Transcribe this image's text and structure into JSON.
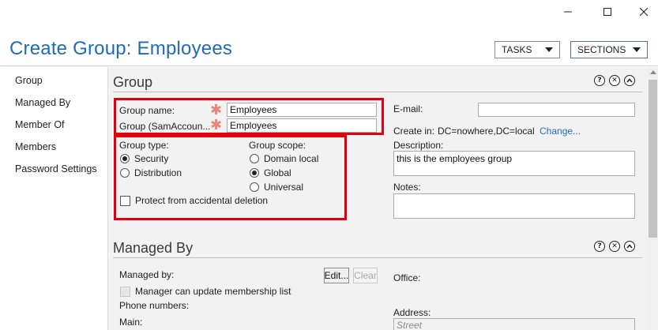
{
  "window": {
    "minimize_icon": "minimize-icon",
    "maximize_icon": "maximize-icon",
    "close_icon": "close-icon"
  },
  "header": {
    "title": "Create Group: Employees",
    "tasks_label": "TASKS",
    "sections_label": "SECTIONS"
  },
  "nav": {
    "items": [
      {
        "label": "Group"
      },
      {
        "label": "Managed By"
      },
      {
        "label": "Member Of"
      },
      {
        "label": "Members"
      },
      {
        "label": "Password Settings"
      }
    ]
  },
  "group_section": {
    "title": "Group",
    "group_name_label": "Group name:",
    "group_name_value": "Employees",
    "sam_label": "Group (SamAccoun...",
    "sam_value": "Employees",
    "group_type_label": "Group type:",
    "type_options": [
      {
        "label": "Security",
        "selected": true
      },
      {
        "label": "Distribution",
        "selected": false
      }
    ],
    "group_scope_label": "Group scope:",
    "scope_options": [
      {
        "label": "Domain local",
        "selected": false
      },
      {
        "label": "Global",
        "selected": true
      },
      {
        "label": "Universal",
        "selected": false
      }
    ],
    "protect_label": "Protect from accidental deletion",
    "protect_checked": false,
    "email_label": "E-mail:",
    "email_value": "",
    "create_in_label": "Create in:",
    "create_in_value": "DC=nowhere,DC=local",
    "change_link": "Change...",
    "description_label": "Description:",
    "description_value": "this is the employees group",
    "notes_label": "Notes:",
    "notes_value": ""
  },
  "managed_by_section": {
    "title": "Managed By",
    "managed_by_label": "Managed by:",
    "edit_button": "Edit...",
    "clear_button": "Clear",
    "manager_update_label": "Manager can update membership list",
    "phone_numbers_label": "Phone numbers:",
    "main_label": "Main:",
    "office_label": "Office:",
    "address_label": "Address:",
    "street_placeholder": "Street"
  },
  "section_controls": {
    "help": "?",
    "close": "✕",
    "collapse": "^"
  },
  "colors": {
    "accent": "#1e6bb8",
    "highlight": "#e0000f",
    "required": "#e8847a"
  }
}
